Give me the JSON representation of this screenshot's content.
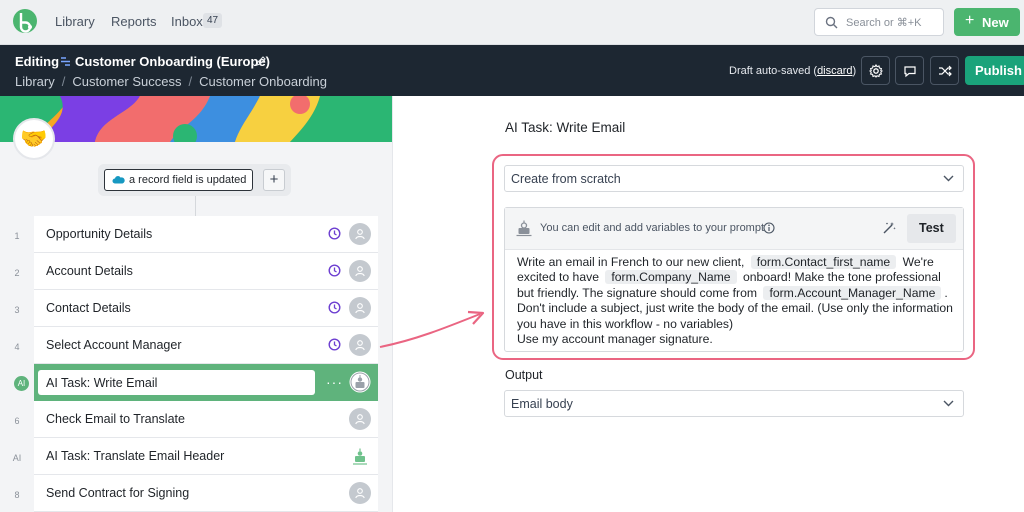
{
  "nav": {
    "library": "Library",
    "reports": "Reports",
    "inbox": "Inbox",
    "inbox_count": "47",
    "search_placeholder": "Search or ⌘+K",
    "new_label": "New"
  },
  "editbar": {
    "editing_label": "Editing",
    "flow_title": "Customer Onboarding (Europe)",
    "breadcrumbs": [
      "Library",
      "Customer Success",
      "Customer Onboarding"
    ],
    "draft_text": "Draft auto-saved",
    "discard_label": "discard",
    "publish_label": "Publish"
  },
  "trigger": {
    "label": "a record field is updated",
    "add_label": "+"
  },
  "steps": [
    {
      "num": "1",
      "label": "Opportunity Details"
    },
    {
      "num": "2",
      "label": "Account Details"
    },
    {
      "num": "3",
      "label": "Contact Details"
    },
    {
      "num": "4",
      "label": "Select Account Manager"
    },
    {
      "num": "AI",
      "label": "AI Task: Write Email"
    },
    {
      "num": "6",
      "label": "Check Email to Translate"
    },
    {
      "num": "AI",
      "label": "AI Task: Translate Email Header"
    },
    {
      "num": "8",
      "label": "Send Contract for Signing"
    }
  ],
  "panel": {
    "title": "AI Task: Write Email",
    "mode_value": "Create from scratch",
    "prompt_hint": "You can edit and add variables to your prompt",
    "test_label": "Test",
    "prompt": {
      "t1": "Write an email in French to our new client,",
      "v1": "form.Contact_first_name",
      "t2": "We're excited to have",
      "v2": "form.Company_Name",
      "t3": "onboard! Make the tone professional but friendly. The signature should come from",
      "v3": "form.Account_Manager_Name",
      "t4": ". Don't include a subject, just write the body of the email. (Use only the information you have in this workflow - no variables)",
      "t5": "Use my account manager signature."
    },
    "output_label": "Output",
    "output_value": "Email body"
  },
  "colors": {
    "brand_green": "#4bb56f",
    "publish_green": "#1aa37a",
    "active_step": "#5fb37c",
    "highlight": "#ea6582",
    "clock_purple": "#6d3fd1",
    "editbar_bg": "#1d2732"
  }
}
